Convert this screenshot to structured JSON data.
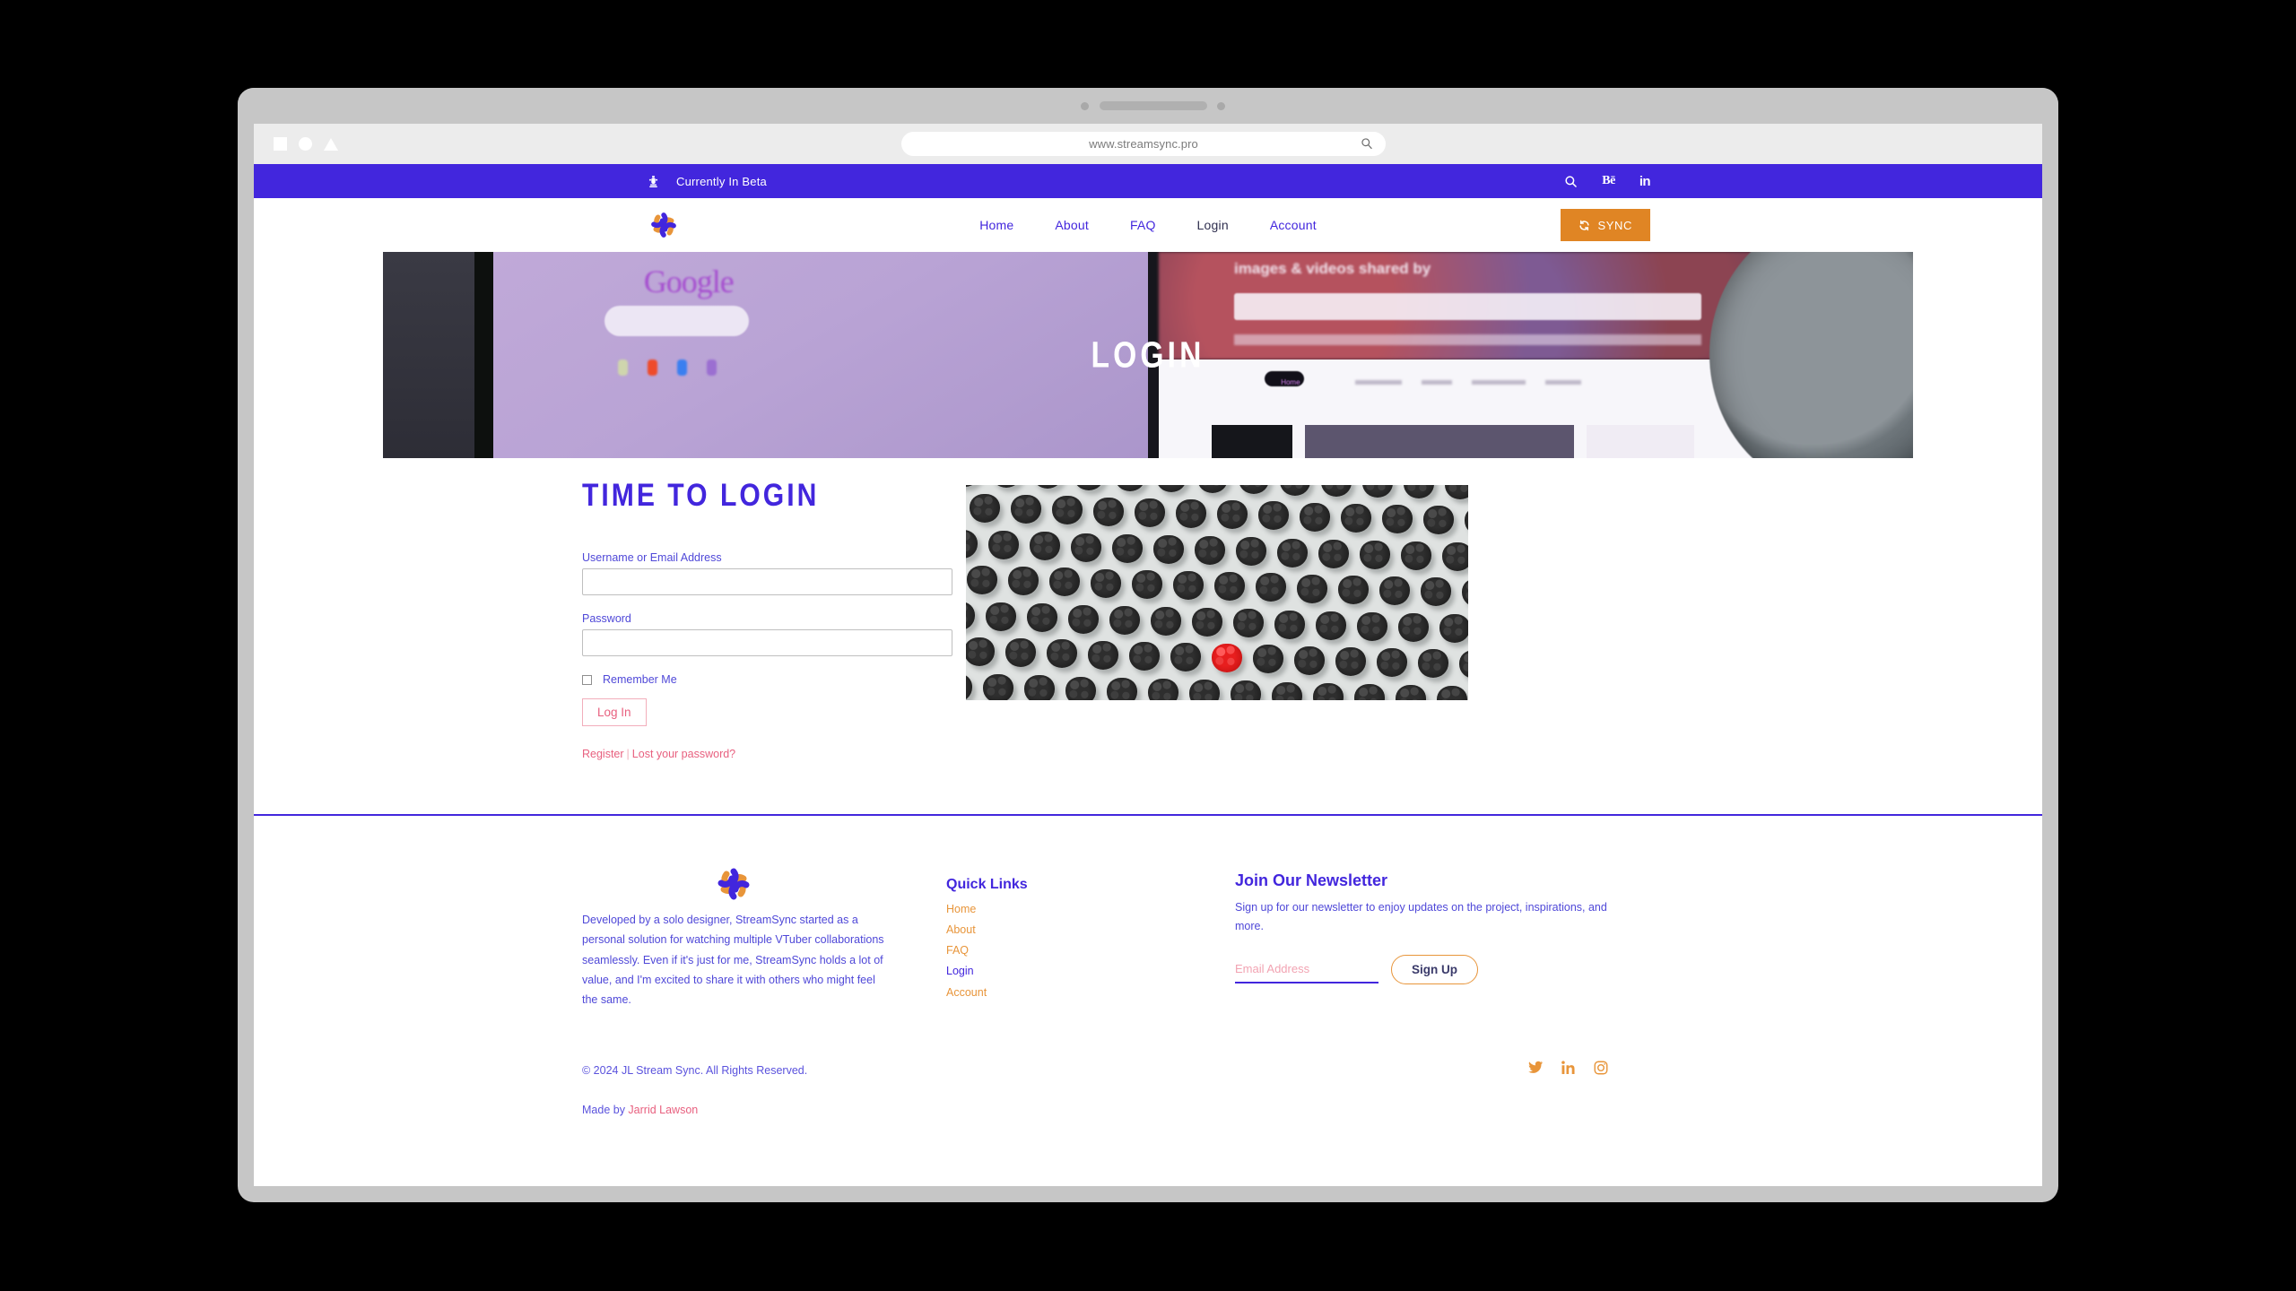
{
  "browser": {
    "url": "www.streamsync.pro",
    "search_icon": "search-icon",
    "window_shapes": [
      "square",
      "circle",
      "triangle"
    ]
  },
  "topbar": {
    "beta_text": "Currently In Beta",
    "beta_icon": "fire-hydrant-icon",
    "icons": [
      {
        "name": "search-icon",
        "label": ""
      },
      {
        "name": "behance-icon",
        "label": "Bē"
      },
      {
        "name": "linkedin-icon",
        "label": "in"
      }
    ]
  },
  "header": {
    "logo": "streamsync-logo",
    "nav": [
      {
        "label": "Home",
        "current": false
      },
      {
        "label": "About",
        "current": false
      },
      {
        "label": "FAQ",
        "current": false
      },
      {
        "label": "Login",
        "current": true
      },
      {
        "label": "Account",
        "current": false
      }
    ],
    "sync_button": {
      "label": "SYNC",
      "icon": "refresh-icon",
      "color": "#e08524"
    }
  },
  "hero": {
    "title": "LOGIN",
    "image_alt": "blurred photo of computer screens showing Google search and an image gallery website"
  },
  "login": {
    "heading": "TIME TO LOGIN",
    "username_label": "Username or Email Address",
    "username_value": "",
    "password_label": "Password",
    "password_value": "",
    "remember_label": "Remember Me",
    "remember_checked": false,
    "submit_label": "Log In",
    "register_label": "Register",
    "separator": "|",
    "lost_password_label": "Lost your password?",
    "side_image_alt": "grid of black blackberries with one red raspberry in the center"
  },
  "footer": {
    "about": {
      "logo": "streamsync-logo",
      "text": "Developed by a solo designer, StreamSync started as a personal solution for watching multiple VTuber collaborations seamlessly. Even if it's just for me, StreamSync holds a lot of value, and I'm excited to share it with others who might feel the same."
    },
    "quick_links": {
      "heading": "Quick Links",
      "items": [
        {
          "label": "Home",
          "current": false
        },
        {
          "label": "About",
          "current": false
        },
        {
          "label": "FAQ",
          "current": false
        },
        {
          "label": "Login",
          "current": true
        },
        {
          "label": "Account",
          "current": false
        }
      ]
    },
    "newsletter": {
      "heading": "Join Our Newsletter",
      "text": "Sign up for our newsletter to enjoy updates on the project, inspirations, and more.",
      "email_value": "",
      "email_placeholder": "Email Address",
      "button_label": "Sign Up"
    },
    "bottom": {
      "copyright": "© 2024 JL Stream Sync. All Rights Reserved.",
      "made_by_prefix": "Made by ",
      "made_by_name": "Jarrid Lawson",
      "social": [
        "twitter-icon",
        "linkedin-icon",
        "instagram-icon"
      ]
    }
  },
  "colors": {
    "brand_purple": "#4226dd",
    "accent_orange": "#e08524",
    "link_orange": "#e8953a",
    "pink": "#e8607f"
  }
}
